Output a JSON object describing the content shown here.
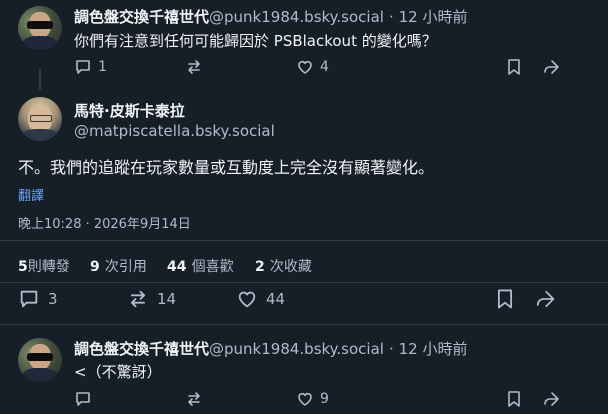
{
  "post1": {
    "author": "調色盤交換千禧世代",
    "handle": "@punk1984.bsky.social",
    "time": "· 12 小時前",
    "text": "你們有注意到任何可能歸因於 PSBlackout 的變化嗎？",
    "replies": "1",
    "likes": "4"
  },
  "main": {
    "author": "馬特·皮斯卡泰拉",
    "handle": "@matpiscatella.bsky.social",
    "text": "不。我們的追蹤在玩家數量或互動度上完全沒有顯著變化。",
    "translate": "翻譯",
    "timestamp": "晚上10:28 · 2026年9月14日",
    "stats": {
      "reposts_num": "5",
      "reposts_label": "則轉發",
      "quotes_num": "9",
      "quotes_label": "次引用",
      "likes_num": "44",
      "likes_label": "個喜歡",
      "saves_num": "2",
      "saves_label": "次收藏"
    },
    "actions": {
      "replies": "3",
      "reposts": "14",
      "likes": "44"
    }
  },
  "post3": {
    "author": "調色盤交換千禧世代",
    "handle": "@punk1984.bsky.social",
    "time": "· 12 小時前",
    "text": "<（不驚訝）",
    "likes": "9"
  }
}
